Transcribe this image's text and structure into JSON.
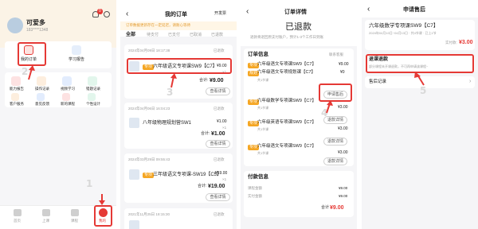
{
  "screen1": {
    "username": "可爱多",
    "user_sub": "183****1348",
    "cart_badge": "0",
    "my_orders": "我的订单",
    "study_report": "学习报告",
    "grid": [
      "能力报告",
      "操作记录",
      "视频学习",
      "错题记录",
      "客户服务",
      "意见反馈",
      "新的课程",
      "个性设计"
    ],
    "tabs": [
      "首页",
      "上课",
      "课程",
      "我的"
    ],
    "step1": "1",
    "step2": "2"
  },
  "screen2": {
    "title": "我的订单",
    "action": "开发票",
    "notice": "订单数据更新存在一定延迟，请耐心等待",
    "tabs": [
      "全部",
      "待支付",
      "已支付",
      "已取消",
      "已退款"
    ],
    "orders": [
      {
        "time": "2024年04月09日 18:17:38",
        "status": "已退款",
        "name": "六年级语文专项课SW9【C7】",
        "badge": "专项",
        "price": "¥9.00",
        "qty": "×1",
        "total_label": "合计:",
        "total": "¥9.00",
        "btn": "查看详情"
      },
      {
        "time": "2024年04月06日 16:04:23",
        "status": "已退款",
        "name": "八年级物理规划营SW1",
        "badge": "",
        "price": "¥1.00",
        "qty": "×1",
        "total_label": "合计:",
        "total": "¥1.00",
        "btn": "查看详情"
      },
      {
        "time": "2024年03月29日 09:55:43",
        "status": "已退款",
        "name": "三年级语文专项课-SW19【C5】",
        "badge": "专项",
        "price": "¥19.00",
        "qty": "×1",
        "total_label": "合计:",
        "total": "¥19.00",
        "btn": "查看详情"
      },
      {
        "time": "2021年11月25日 18:15:30",
        "status": "已退款",
        "name": "",
        "badge": "",
        "price": "",
        "qty": "",
        "total_label": "",
        "total": "",
        "btn": ""
      }
    ],
    "step3": "3"
  },
  "screen3": {
    "title": "订单详情",
    "status_big": "已退款",
    "status_sub": "退款将退回原支付账户，预计1-3个工作日到账",
    "section": "订单信息",
    "section_action": "联系客服",
    "items": [
      {
        "badge": "专项",
        "name": "六年级语文专项课SW9【C7】",
        "price": "¥9.00"
      },
      {
        "badge": "规划",
        "name": "六年级语文专项规划课【C7】",
        "price": "¥0"
      },
      {
        "badge": "专项",
        "name": "六年级数学专项课SW9【C7】",
        "price": "¥3.00"
      },
      {
        "badge": "专项",
        "name": "六年级英语专项课SW9【C7】",
        "price": "¥3.00"
      },
      {
        "badge": "专项",
        "name": "六年级语文专项课SW9【C7】",
        "price": "¥3.00"
      }
    ],
    "item_sub": "共1节课",
    "apply_btn": "申请售后",
    "detail_btn": "退款详情",
    "pay_section": "付款信息",
    "pay_rows": [
      {
        "label": "课程金额",
        "value": "¥9.00"
      },
      {
        "label": "实付金额",
        "value": "¥9.00"
      }
    ],
    "total_label": "合计",
    "total": "¥9.00",
    "step4": "4"
  },
  "screen4": {
    "title": "申请售后",
    "course_name": "六年级数学专项课SW9【C7】",
    "course_sub": "2024年04月10日~04月13日 · 共4节课 · 已上1节",
    "price": "¥3.00",
    "paid_label": "实付款:",
    "refund_title": "退课退款",
    "refund_sub": "部分课程未开课退款，不可再申请该课程~",
    "history": "售后记录",
    "step5": "5"
  },
  "colors": {
    "accent": "#e53935",
    "badge": "#f5a623",
    "page_bg": "#f5f5f7"
  }
}
